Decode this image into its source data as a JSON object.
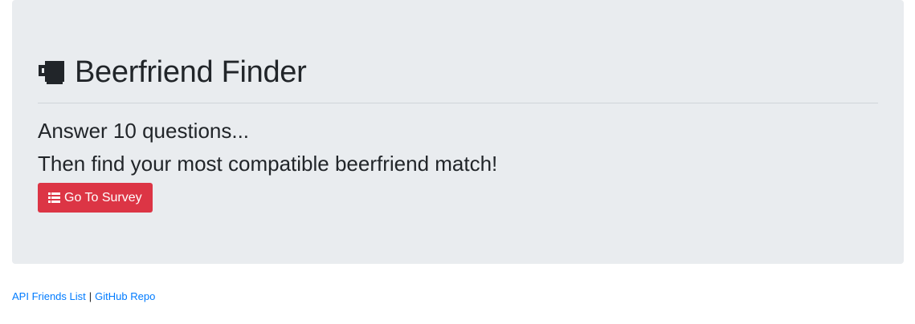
{
  "header": {
    "title": "Beerfriend Finder",
    "icon": "beer-icon"
  },
  "main": {
    "line1": "Answer 10 questions...",
    "line2": "Then find your most compatible beerfriend match!",
    "survey_button": {
      "label": "Go To Survey",
      "icon": "list-icon",
      "color": "#dc3545"
    }
  },
  "footer": {
    "api_link": "API Friends List",
    "separator": "|",
    "github_link": "GitHub Repo",
    "link_color": "#007bff"
  },
  "colors": {
    "jumbotron_bg": "#e9ecef",
    "text": "#212529"
  }
}
